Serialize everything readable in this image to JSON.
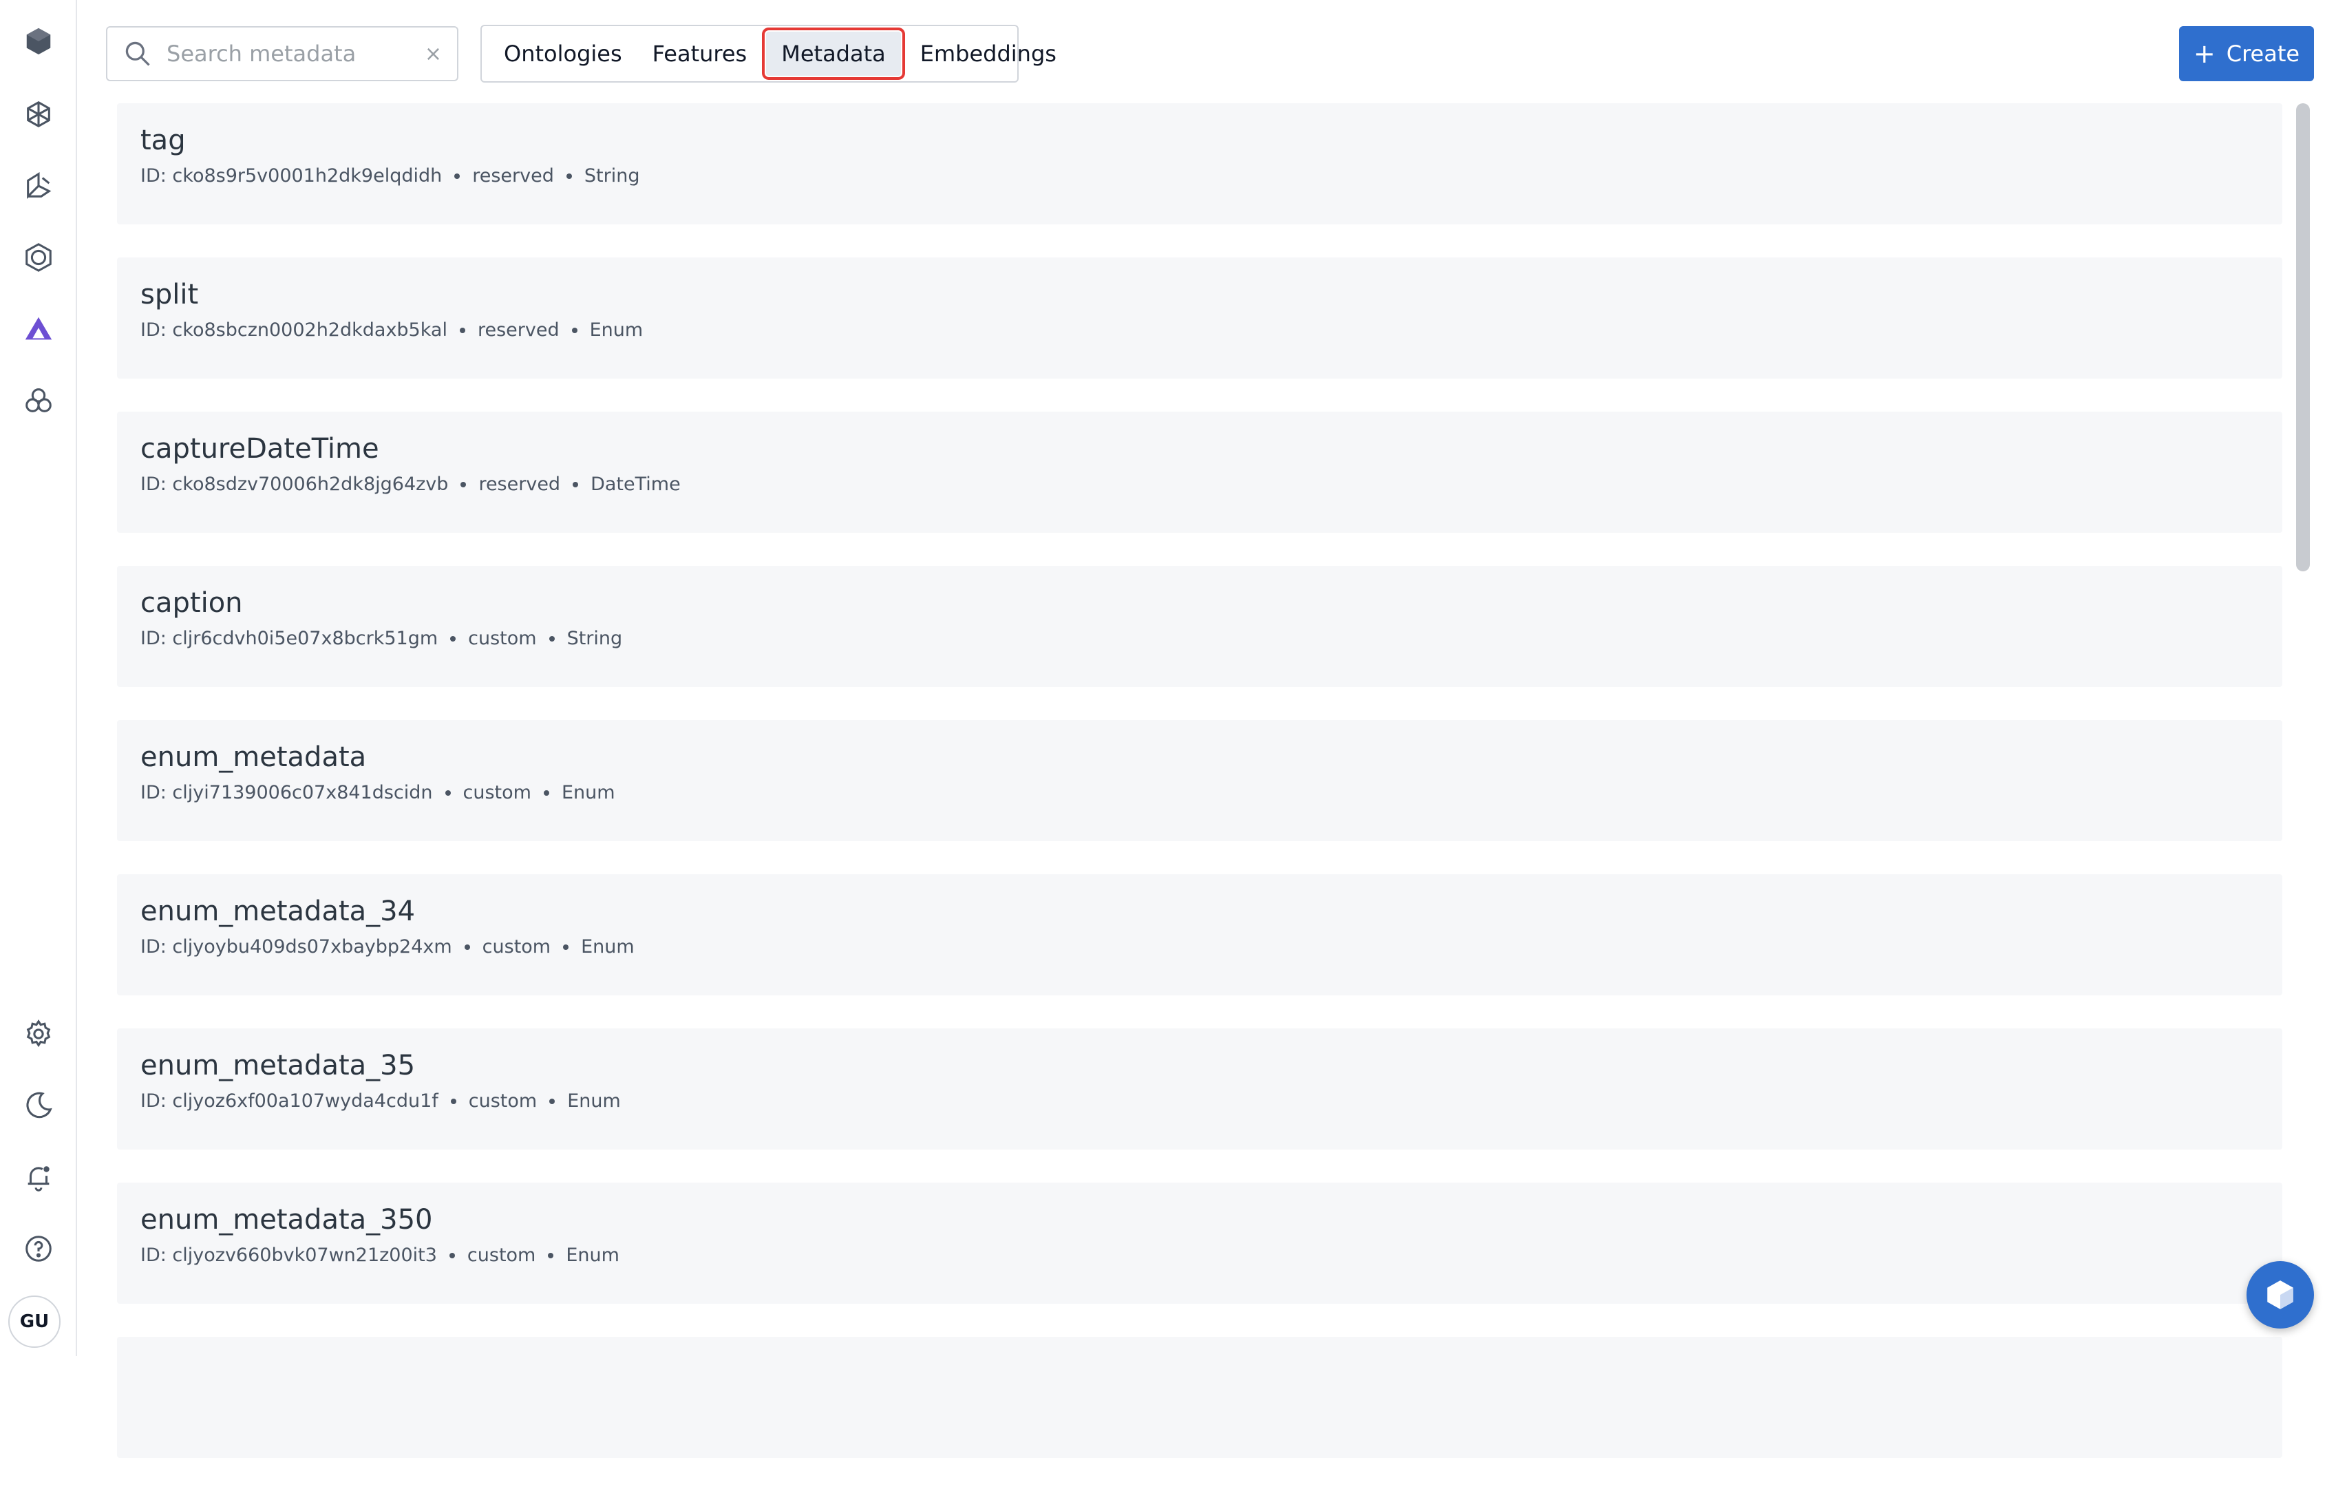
{
  "rail": {
    "icons": [
      "logo-cube-icon",
      "catalog-icon",
      "annotate-icon",
      "model-icon",
      "schema-icon",
      "workspace-icon",
      "settings-icon",
      "dark-mode-icon",
      "notifications-icon",
      "help-icon"
    ],
    "accent": "#6d4fd3",
    "avatar_initials": "GU"
  },
  "search": {
    "placeholder": "Search metadata",
    "value": "",
    "clear_symbol": "×"
  },
  "tabs": [
    {
      "label": "Ontologies",
      "selected": false
    },
    {
      "label": "Features",
      "selected": false
    },
    {
      "label": "Metadata",
      "selected": true
    },
    {
      "label": "Embeddings",
      "selected": false
    }
  ],
  "create_button": {
    "label": "Create",
    "color": "#2f6fce"
  },
  "metadata_items": [
    {
      "name": "tag",
      "id_label": "ID: cko8s9r5v0001h2dk9elqdidh",
      "kind": "reserved",
      "type": "String"
    },
    {
      "name": "split",
      "id_label": "ID: cko8sbczn0002h2dkdaxb5kal",
      "kind": "reserved",
      "type": "Enum"
    },
    {
      "name": "captureDateTime",
      "id_label": "ID: cko8sdzv70006h2dk8jg64zvb",
      "kind": "reserved",
      "type": "DateTime"
    },
    {
      "name": "caption",
      "id_label": "ID: cljr6cdvh0i5e07x8bcrk51gm",
      "kind": "custom",
      "type": "String"
    },
    {
      "name": "enum_metadata",
      "id_label": "ID: cljyi7139006c07x841dscidn",
      "kind": "custom",
      "type": "Enum"
    },
    {
      "name": "enum_metadata_34",
      "id_label": "ID: cljyoybu409ds07xbaybp24xm",
      "kind": "custom",
      "type": "Enum"
    },
    {
      "name": "enum_metadata_35",
      "id_label": "ID: cljyoz6xf00a107wyda4cdu1f",
      "kind": "custom",
      "type": "Enum"
    },
    {
      "name": "enum_metadata_350",
      "id_label": "ID: cljyozv660bvk07wn21z00it3",
      "kind": "custom",
      "type": "Enum"
    }
  ]
}
